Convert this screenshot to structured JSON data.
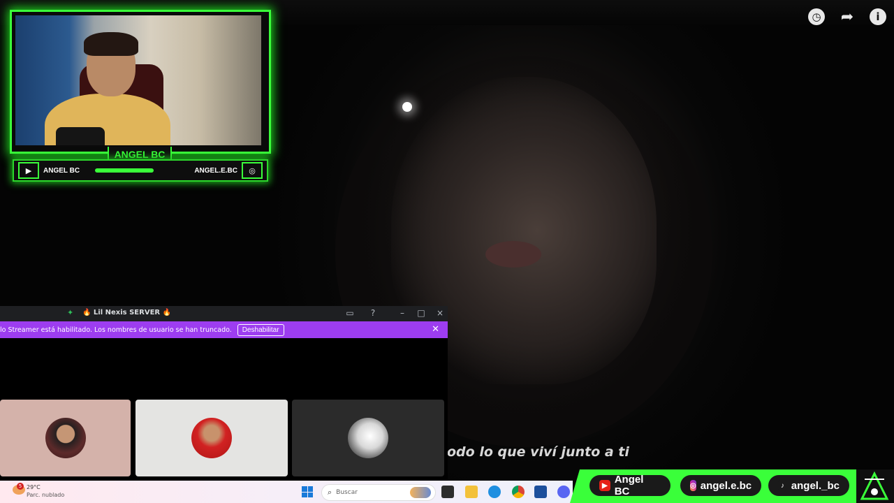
{
  "video": {
    "subtitle": "odo lo que viví junto a ti"
  },
  "webcam": {
    "name": "ANGEL BC",
    "youtube_handle": "ANGEL BC",
    "instagram_handle": "ANGEL.E.BC"
  },
  "discord": {
    "server_title": "🔥 Lil Nexis SERVER 🔥",
    "banner_text": "lo Streamer está habilitado. Los nombres de usuario se han truncado.",
    "banner_button": "Deshabilitar"
  },
  "taskbar": {
    "weather_badge": "5",
    "temperature": "29°C",
    "weather": "Parc. nublado",
    "search_placeholder": "Buscar"
  },
  "social": {
    "youtube": "Angel BC",
    "instagram": "angel.e.bc",
    "tiktok": "angel._bc"
  },
  "colors": {
    "accent_green": "#3aff3a",
    "discord_purple": "#9d3df0"
  }
}
